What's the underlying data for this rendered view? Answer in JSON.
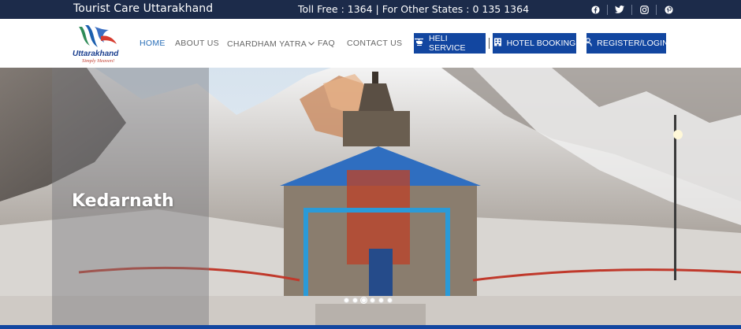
{
  "topbar": {
    "site_name": "Tourist Care Uttarakhand",
    "tollfree": "Toll Free : 1364 | For Other States : 0 135 1364",
    "socials": [
      "facebook-icon",
      "twitter-icon",
      "instagram-icon",
      "pinterest-icon"
    ]
  },
  "logo": {
    "name": "Uttarakhand",
    "tagline": "Simply Heaven!"
  },
  "nav": {
    "items": [
      "HOME",
      "ABOUT US",
      "CHARDHAM YATRA",
      "FAQ",
      "CONTACT US"
    ],
    "active": "HOME"
  },
  "buttons": {
    "heli": "HELI SERVICE",
    "hotel": "HOTEL BOOKING",
    "register": "REGISTER/LOGIN"
  },
  "hero": {
    "title": "Kedarnath",
    "slide_count": 6,
    "active_slide": 3
  },
  "colors": {
    "topbar": "#1c2b4a",
    "primary": "#1246a0",
    "nav_active": "#2a6fb8"
  }
}
